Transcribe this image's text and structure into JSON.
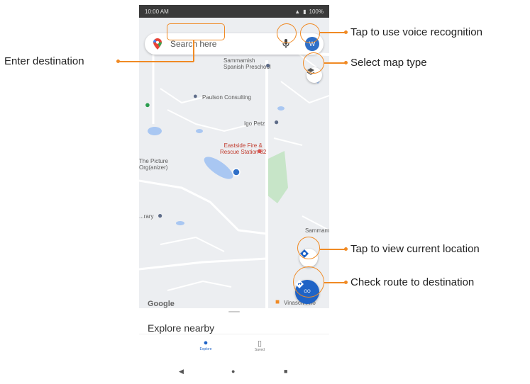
{
  "status_bar": {
    "time": "10:00 AM",
    "battery": "100%"
  },
  "search": {
    "placeholder": "Search here",
    "avatar_initial": "W"
  },
  "map": {
    "places": [
      {
        "name": "Sammamish Spanish Preschool",
        "line1": "Sammamish",
        "line2": "Spanish Preschool"
      },
      {
        "name": "Paulson Consulting"
      },
      {
        "name": "Igo Petz"
      },
      {
        "name": "Eastside Fire & Rescue Station 82",
        "line1": "Eastside Fire &",
        "line2": "Rescue Station 82"
      },
      {
        "name": "The Picture Org(anizer)",
        "line1": "The Picture",
        "line2": "Org(anizer)"
      },
      {
        "name": "...rary"
      },
      {
        "name": "Sammam..."
      },
      {
        "name": "Vinasch Pho"
      }
    ],
    "logo": "Google"
  },
  "go_button": {
    "label": "GO"
  },
  "bottom_sheet": {
    "title": "Explore nearby"
  },
  "nav_tabs": [
    {
      "label": "Explore",
      "icon": "map-pin-icon"
    },
    {
      "label": "Saved",
      "icon": "bookmark-icon"
    }
  ],
  "callouts": {
    "enter_destination": "Enter destination",
    "voice": "Tap to use voice recognition",
    "map_type": "Select map type",
    "current_location": "Tap to view current location",
    "route": "Check route to destination"
  },
  "colors": {
    "accent_orange": "#f08a24",
    "maps_blue": "#1f63c6"
  }
}
